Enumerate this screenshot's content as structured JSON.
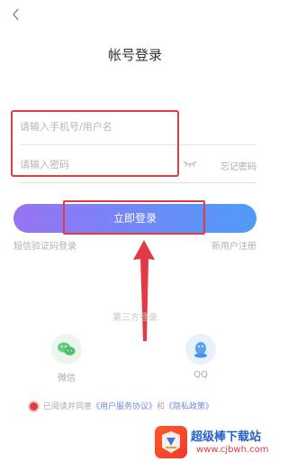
{
  "header": {
    "back_icon": "chevron-left-icon",
    "title": "帐号登录"
  },
  "form": {
    "username_placeholder": "请输入手机号/用户名",
    "username_value": "",
    "password_placeholder": "请输入密码",
    "password_value": "",
    "visibility_icon": "eye-closed-icon",
    "forgot_label": "忘记密码"
  },
  "actions": {
    "login_label": "立即登录",
    "sms_login_label": "短信验证码登录",
    "register_label": "新用户注册"
  },
  "third_party": {
    "title": "第三方登录",
    "providers": [
      {
        "label": "微信",
        "icon": "wechat-icon"
      },
      {
        "label": "QQ",
        "icon": "qq-icon"
      }
    ]
  },
  "agreement": {
    "prefix": "已阅读并同意",
    "terms_link": "《用户服务协议》",
    "conjunction": "和",
    "privacy_link": "《隐私政策》"
  },
  "annotations": {
    "highlight_color": "#e23b45"
  },
  "watermark": {
    "title": "超级棒下载站",
    "url": "www.cjbwh.com"
  },
  "colors": {
    "button_gradient_start": "#9a72f2",
    "button_gradient_end": "#4f9cf7",
    "link": "#6f8de0"
  }
}
